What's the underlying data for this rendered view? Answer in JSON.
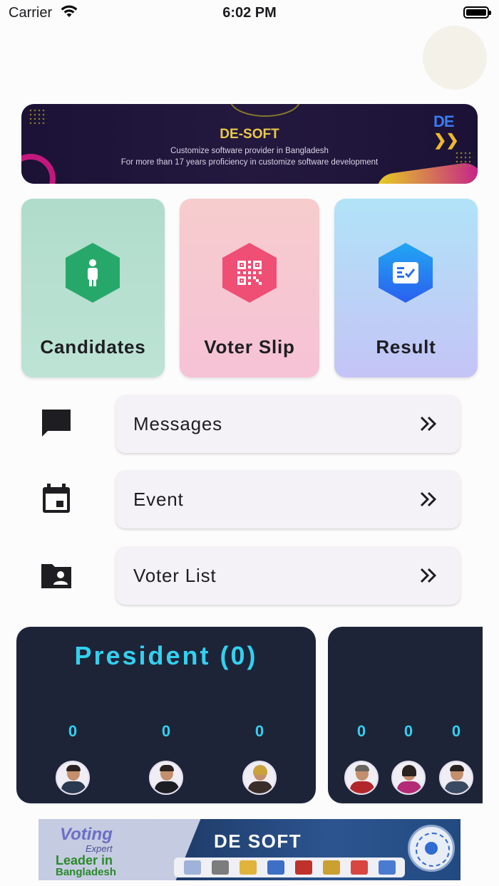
{
  "status_bar": {
    "carrier": "Carrier",
    "time": "6:02 PM"
  },
  "banner": {
    "title": "DE-SOFT",
    "line1": "Customize software provider in Bangladesh",
    "line2": "For more than 17 years proficiency in customize software development",
    "logo": "DE"
  },
  "cards": [
    {
      "label": "Candidates",
      "icon": "person-icon",
      "color": "#27a86b"
    },
    {
      "label": "Voter Slip",
      "icon": "qr-code-icon",
      "color": "#ef4e75"
    },
    {
      "label": "Result",
      "icon": "checklist-icon",
      "color": "#2b5ff0"
    }
  ],
  "menu": [
    {
      "label": "Messages",
      "icon": "message-icon"
    },
    {
      "label": "Event",
      "icon": "calendar-icon"
    },
    {
      "label": "Voter List",
      "icon": "folder-person-icon"
    }
  ],
  "positions": [
    {
      "title": "President (0)",
      "votes": [
        "0",
        "0",
        "0"
      ]
    },
    {
      "title": "",
      "votes": [
        "0",
        "0",
        "0"
      ]
    }
  ],
  "ad": {
    "voting": "Voting",
    "expert": "Expert",
    "leader": "Leader in",
    "country": "Bangladesh",
    "company": "DE SOFT"
  },
  "colors": {
    "accent": "#33d0ef",
    "panel": "#1e2438"
  }
}
